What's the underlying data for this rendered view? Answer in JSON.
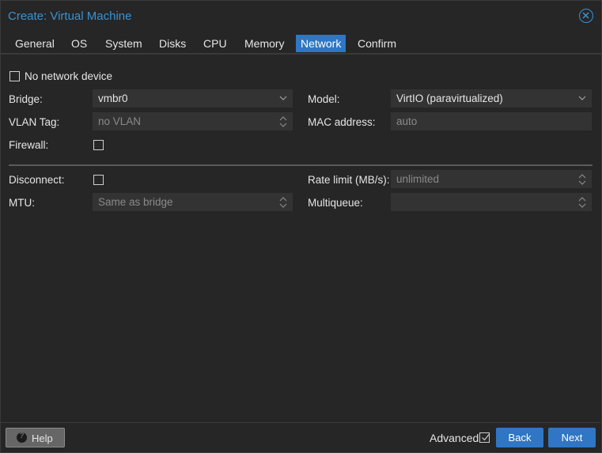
{
  "window": {
    "title": "Create: Virtual Machine"
  },
  "tabs": [
    {
      "label": "General"
    },
    {
      "label": "OS"
    },
    {
      "label": "System"
    },
    {
      "label": "Disks"
    },
    {
      "label": "CPU"
    },
    {
      "label": "Memory"
    },
    {
      "label": "Network",
      "active": true
    },
    {
      "label": "Confirm"
    }
  ],
  "form": {
    "no_network_device": {
      "label": "No network device",
      "checked": false
    },
    "bridge": {
      "label": "Bridge:",
      "value": "vmbr0"
    },
    "vlan_tag": {
      "label": "VLAN Tag:",
      "value": "no VLAN"
    },
    "firewall": {
      "label": "Firewall:",
      "checked": false
    },
    "model": {
      "label": "Model:",
      "value": "VirtIO (paravirtualized)"
    },
    "mac_address": {
      "label": "MAC address:",
      "value": "auto"
    },
    "disconnect": {
      "label": "Disconnect:",
      "checked": false
    },
    "mtu": {
      "label": "MTU:",
      "value": "Same as bridge"
    },
    "rate_limit": {
      "label": "Rate limit (MB/s):",
      "value": "unlimited"
    },
    "multiqueue": {
      "label": "Multiqueue:",
      "value": ""
    }
  },
  "footer": {
    "help_label": "Help",
    "advanced_label": "Advanced",
    "advanced_checked": true,
    "back_label": "Back",
    "next_label": "Next"
  },
  "colors": {
    "accent": "#2f76c4",
    "title": "#3892d4",
    "background": "#262626",
    "field": "#333333"
  },
  "icons": {
    "close": "close-icon",
    "dropdown": "chevron-down-icon",
    "spinner": "spinner-arrows-icon",
    "help": "question-circle-icon",
    "check": "checkmark-icon"
  }
}
